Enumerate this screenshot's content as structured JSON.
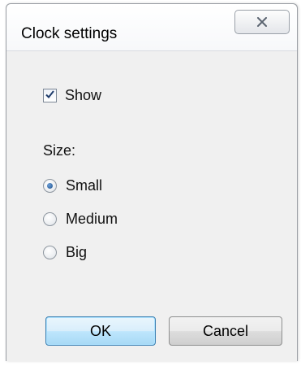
{
  "window": {
    "title": "Clock settings"
  },
  "show_checkbox": {
    "label": "Show",
    "checked": true
  },
  "size_group": {
    "label": "Size:",
    "options": [
      {
        "label": "Small",
        "selected": true
      },
      {
        "label": "Medium",
        "selected": false
      },
      {
        "label": "Big",
        "selected": false
      }
    ]
  },
  "buttons": {
    "ok_label": "OK",
    "cancel_label": "Cancel"
  },
  "icons": {
    "close": "close-icon",
    "check": "checkmark-icon"
  },
  "colors": {
    "dialog_bg": "#f0f0f0",
    "ok_border": "#3c7fb1",
    "radio_selected": "#1b4f8c"
  }
}
